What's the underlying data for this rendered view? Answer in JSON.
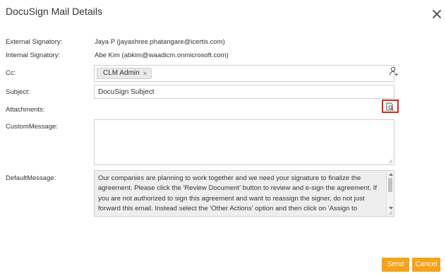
{
  "dialog": {
    "title": "DocuSign Mail Details"
  },
  "fields": {
    "external_signatory": {
      "label": "External Signatory:",
      "value": "Jaya P (jayashree.phatangare@icertis.com)"
    },
    "internal_signatory": {
      "label": "Internal Signatory:",
      "value": "Abe Kim (abkim@waadicm.onmicrosoft.com)"
    },
    "cc": {
      "label": "Cc:",
      "chips": [
        "CLM Admin"
      ],
      "chip_remove": "×"
    },
    "subject": {
      "label": "Subject:",
      "value": "DocuSign Subject"
    },
    "attachments": {
      "label": "Attachments:"
    },
    "custom_message": {
      "label": "CustomMessage:",
      "value": ""
    },
    "default_message": {
      "label": "DefaultMessage:",
      "value": "Our companies are planning to work together and we need your signature to finalize the agreement. Please click the 'Review Document' button to review and e-sign the agreement. If you are not authorized to sign this agreement and want to reassign the signer, do not just forward this email. Instead select the 'Other Actions' option and then click on 'Assign to Someone Else' button once you enter the signing ceremony. The above text in this email is not intended to be and does not"
    }
  },
  "buttons": {
    "send": "Send",
    "cancel": "Cancel"
  },
  "icons": {
    "close": "close-icon",
    "add_user": "add-user-icon",
    "attachment": "attachment-preview-icon"
  },
  "colors": {
    "accent": "#f4a31b",
    "highlight_border": "#d9261c"
  }
}
